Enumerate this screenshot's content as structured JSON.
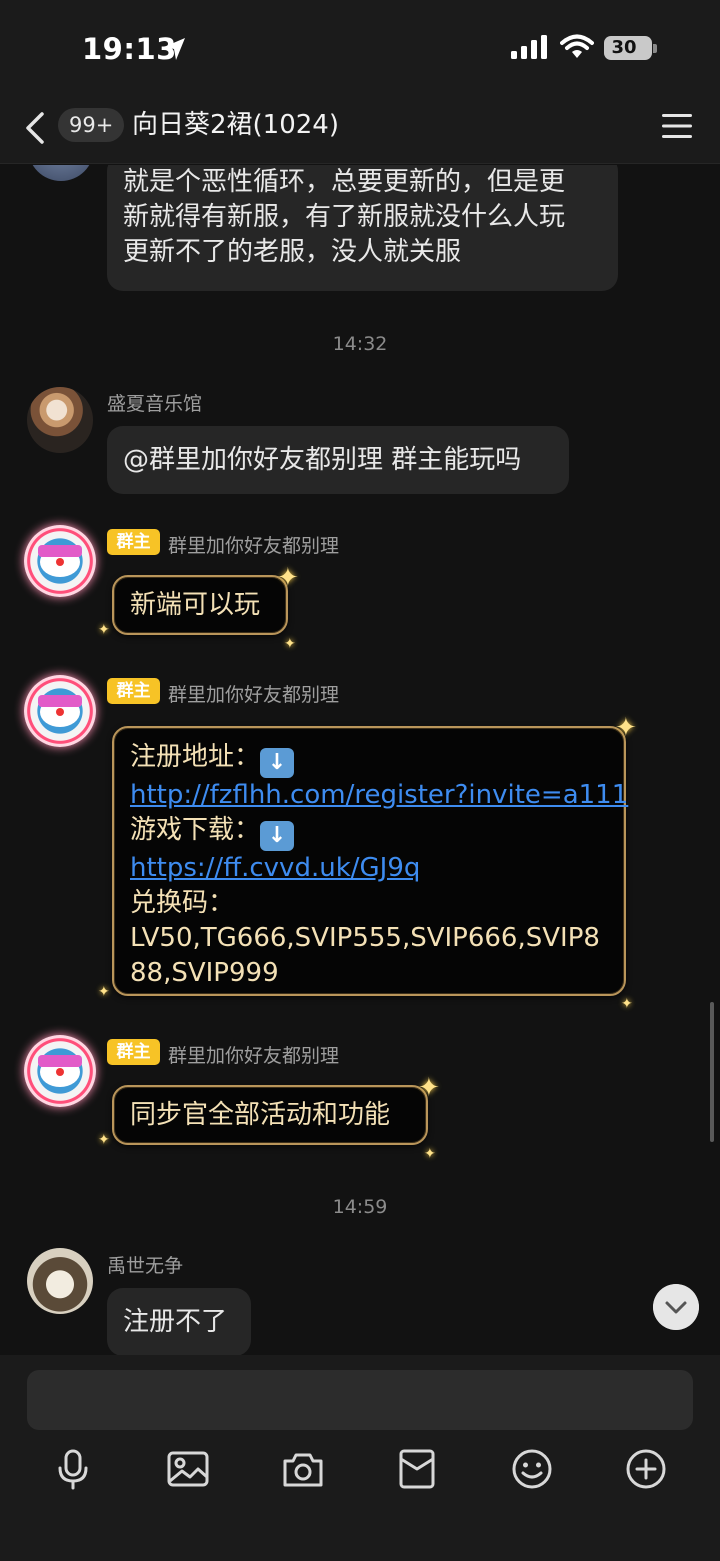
{
  "status_bar": {
    "time": "19:13",
    "battery": "30",
    "icons": [
      "location-arrow-icon",
      "signal-icon",
      "wifi-icon",
      "battery-icon"
    ]
  },
  "nav": {
    "unread_badge": "99+",
    "title": "向日葵2裙(1024)",
    "back_icon": "chevron-left-icon",
    "menu_icon": "hamburger-menu-icon"
  },
  "messages": {
    "first": {
      "lines": [
        "就是个恶性循环，总要更新的，但是更",
        "新就得有新服，有了新服就没什么人玩",
        "更新不了的老服，没人就关服"
      ]
    },
    "time1": "14:32",
    "summer": {
      "sender": "盛夏音乐馆",
      "text": "@群里加你好友都别理 群主能玩吗"
    },
    "owner1": {
      "tag": "群主",
      "sender": "群里加你好友都别理",
      "text": "新端可以玩"
    },
    "owner2": {
      "tag": "群主",
      "sender": "群里加你好友都别理",
      "register_label": "注册地址：",
      "register_link": "http://fzflhh.com/register?invite=a111",
      "download_label": "游戏下载：",
      "download_link": "https://ff.cvvd.uk/GJ9q",
      "code_label": "兑换码：",
      "code_line1": "LV50,TG666,SVIP555,SVIP666,SVIP8",
      "code_line2": "88,SVIP999"
    },
    "owner3": {
      "tag": "群主",
      "sender": "群里加你好友都别理",
      "text": "同步官全部活动和功能"
    },
    "time2": "14:59",
    "yu": {
      "sender": "禹世无争",
      "text": "注册不了"
    }
  },
  "input": {
    "placeholder": ""
  },
  "toolbar": [
    "microphone-icon",
    "image-icon",
    "camera-icon",
    "red-packet-icon",
    "emoji-icon",
    "plus-icon"
  ],
  "colors": {
    "background": "#121212",
    "bubble": "#262626",
    "owner_tag": "#f7c326",
    "gold_border": "#b9955a",
    "link": "#3e8cf0"
  }
}
